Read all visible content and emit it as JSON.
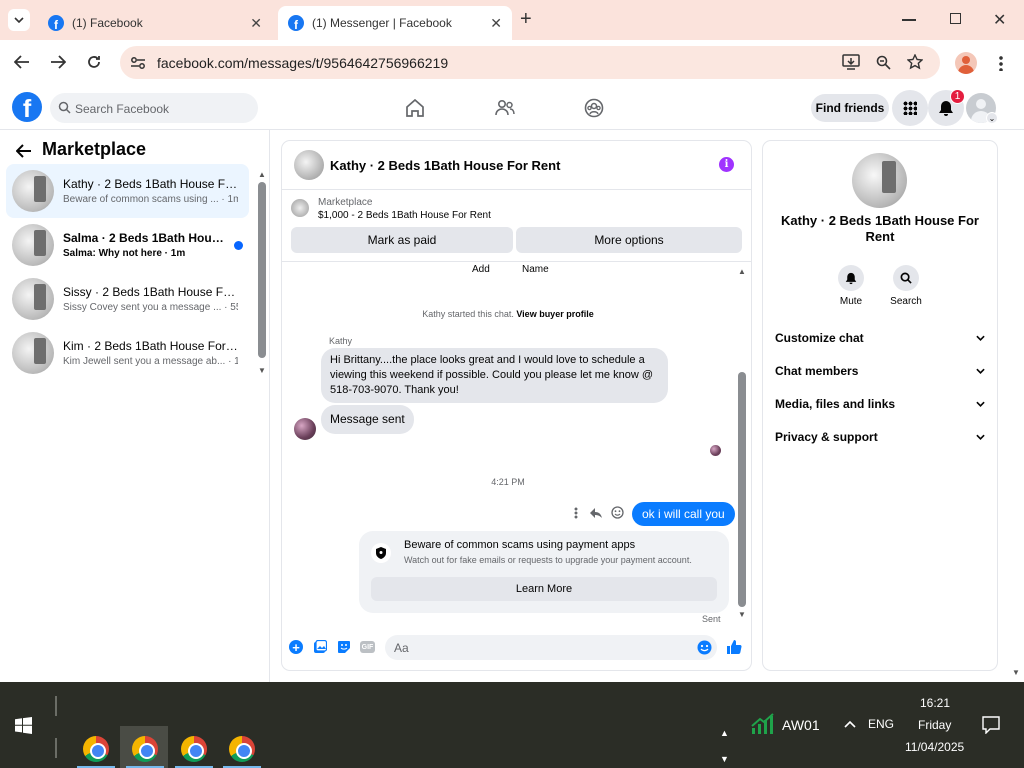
{
  "browser": {
    "tabs": [
      {
        "title": "(1) Facebook"
      },
      {
        "title": "(1) Messenger | Facebook"
      }
    ],
    "url": "facebook.com/messages/t/9564642756966219"
  },
  "fb": {
    "search_placeholder": "Search Facebook",
    "find_friends": "Find friends",
    "notification_count": "1"
  },
  "left": {
    "title": "Marketplace",
    "conversations": [
      {
        "name": "Kathy · 2 Beds 1Bath House For ...",
        "preview": "Beware of common scams using ... · 1m"
      },
      {
        "name": "Salma · 2 Beds 1Bath House F...",
        "preview": "Salma: Why not here · 1m"
      },
      {
        "name": "Sissy · 2 Beds 1Bath House For ...",
        "preview": "Sissy Covey sent you a message ... · 55m"
      },
      {
        "name": "Kim · 2 Beds 1Bath House For R...",
        "preview": "Kim Jewell sent you a message ab... · 1h"
      }
    ]
  },
  "chat": {
    "title": "Kathy · 2 Beds 1Bath House For Rent",
    "listing_source": "Marketplace",
    "listing": "$1,000 - 2 Beds 1Bath House For Rent",
    "mark_paid": "Mark as paid",
    "more_options": "More options",
    "col_add": "Add",
    "col_name": "Name",
    "started_prefix": "Kathy started this chat.",
    "view_buyer": "View buyer profile",
    "sender_name": "Kathy",
    "message1": "Hi Brittany....the place looks great and I would love to schedule a viewing this weekend if possible. Could you please let me know @ 518-703-9070. Thank you!",
    "message2": "Message sent",
    "timestamp": "4:21 PM",
    "my_message": "ok i will call you",
    "scam_title": "Beware of common scams using payment apps",
    "scam_body": "Watch out for fake emails or requests to upgrade your payment account.",
    "learn_more": "Learn More",
    "sent": "Sent",
    "composer_placeholder": "Aa",
    "gif_label": "GIF"
  },
  "right": {
    "title": "Kathy · 2 Beds 1Bath House For Rent",
    "mute": "Mute",
    "search": "Search",
    "sections": [
      "Customize chat",
      "Chat members",
      "Media, files and links",
      "Privacy & support"
    ]
  },
  "taskbar": {
    "app_label": "AW01",
    "lang": "ENG",
    "time": "16:21",
    "day": "Friday",
    "date": "11/04/2025"
  },
  "colors": {
    "fb_blue": "#1877f2",
    "messenger_blue": "#0a7cff",
    "info_purple": "#a033ff",
    "taskbar": "#2b2d26"
  }
}
